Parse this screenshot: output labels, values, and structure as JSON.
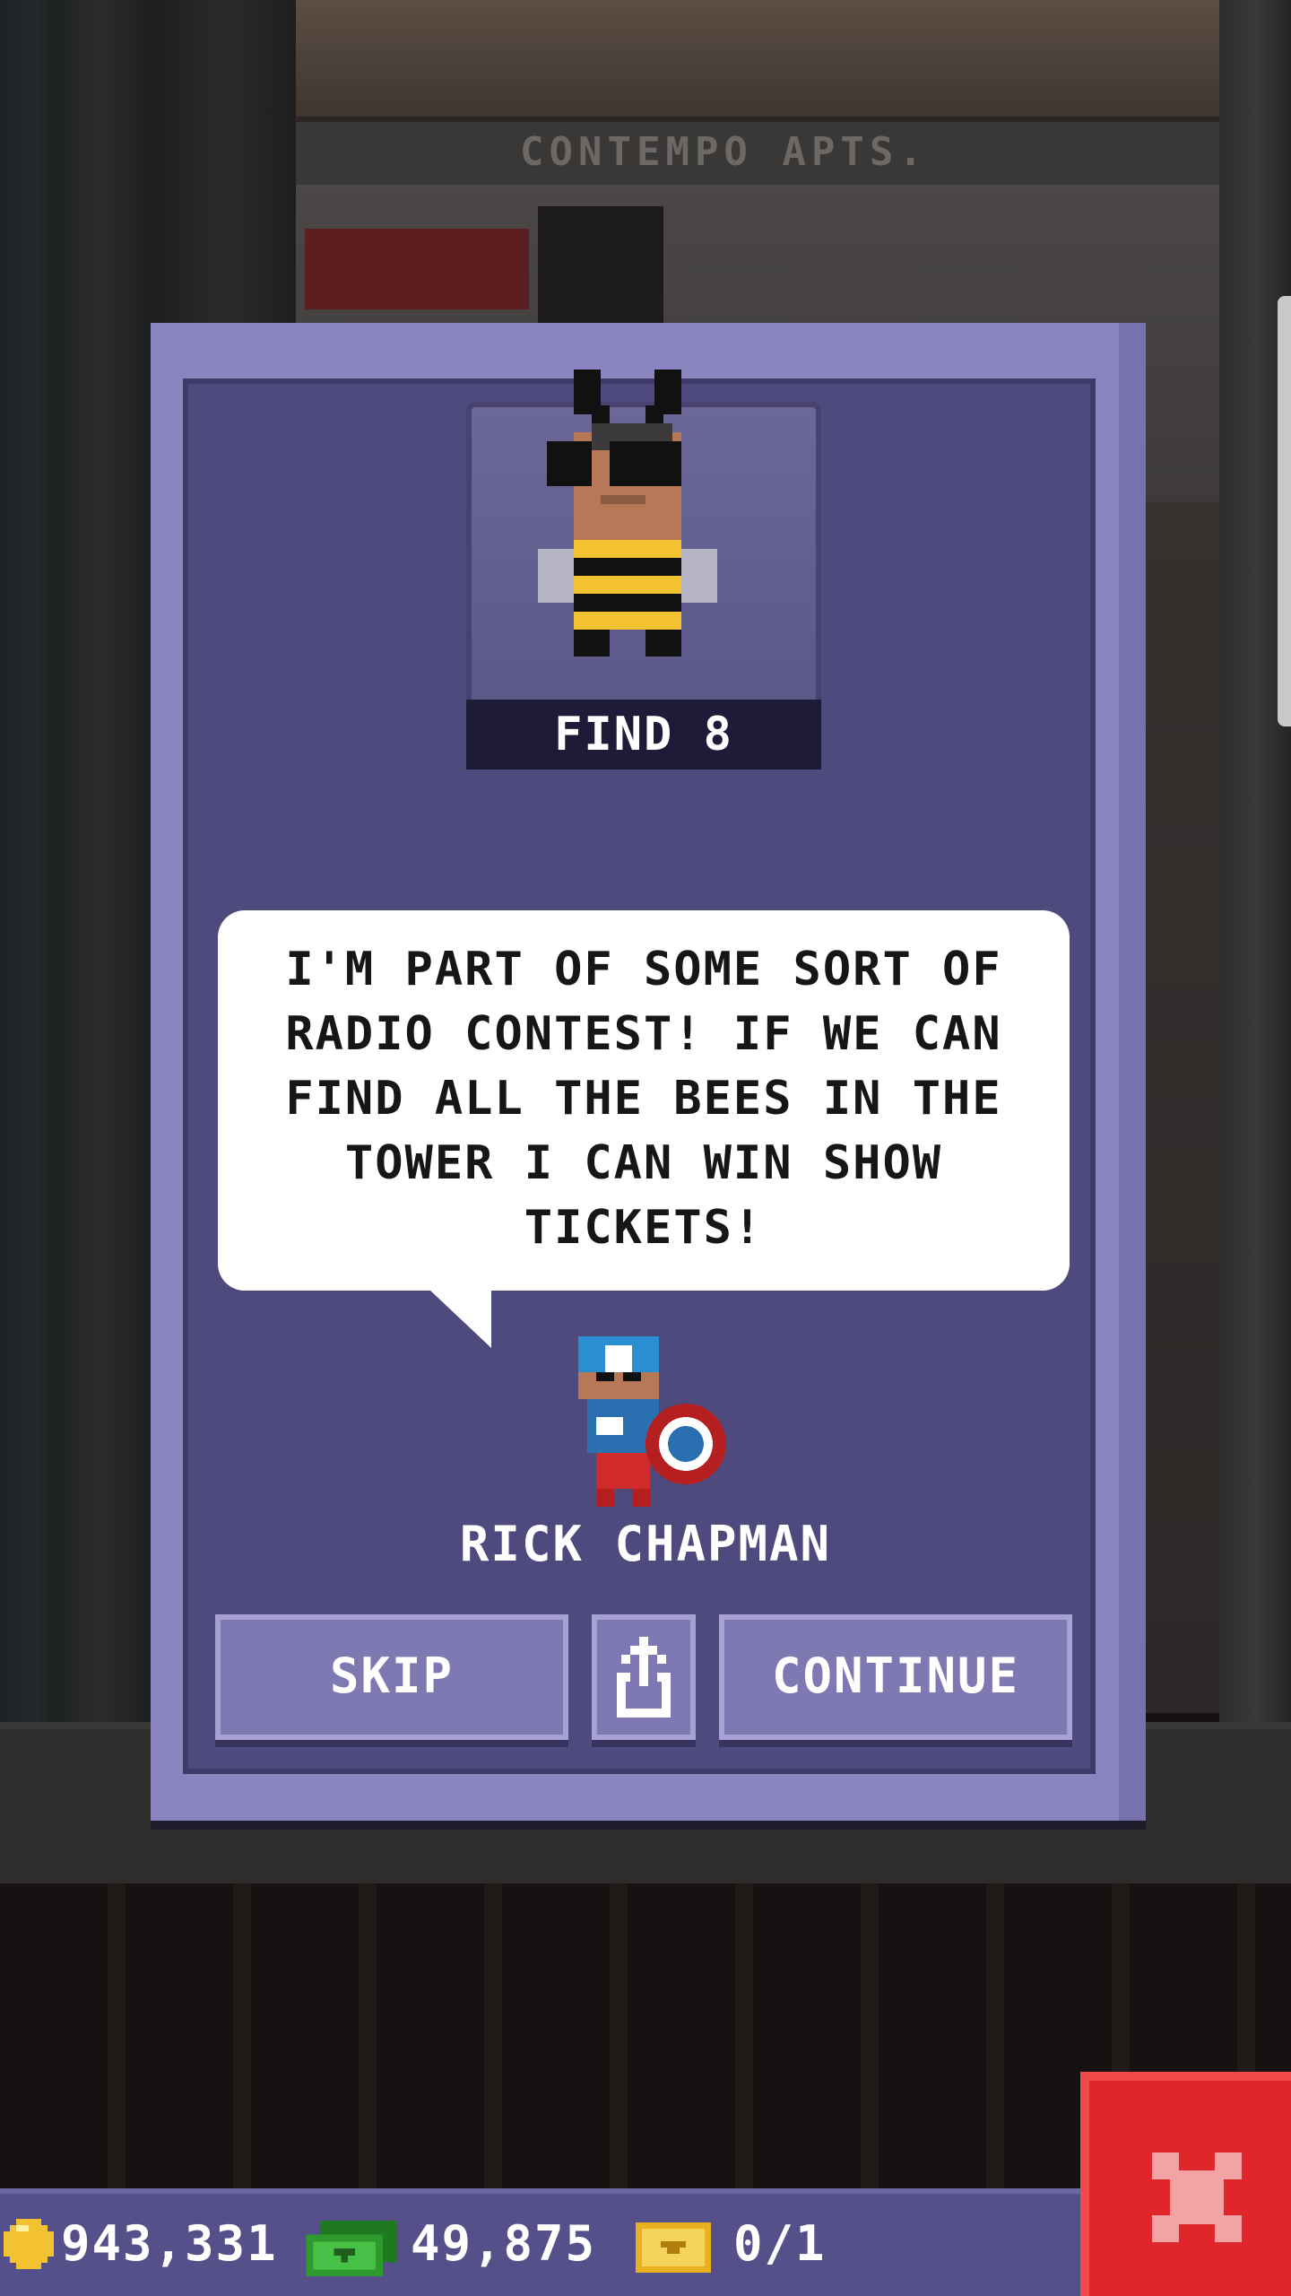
{
  "background": {
    "floor_sign": "CONTEMPO APTS."
  },
  "event": {
    "portrait_label": "FIND 8",
    "dialog_text": "I'M PART OF SOME SORT OF RADIO CONTEST! IF WE CAN FIND ALL THE BEES IN THE TOWER I CAN WIN SHOW TICKETS!",
    "speaker_name": "RICK CHAPMAN"
  },
  "buttons": {
    "skip_label": "SKIP",
    "continue_label": "CONTINUE",
    "share_icon": "share-icon"
  },
  "status_bar": {
    "coins": "943,331",
    "bux": "49,875",
    "tickets": "0/1"
  },
  "colors": {
    "dialog_border": "#8a84c0",
    "dialog_fill": "#4f4a7d",
    "button_fill": "#7e79b2",
    "close_button": "#e0262b",
    "coin": "#f2c230",
    "bux": "#2e9a2e",
    "ticket": "#e8b21f"
  }
}
